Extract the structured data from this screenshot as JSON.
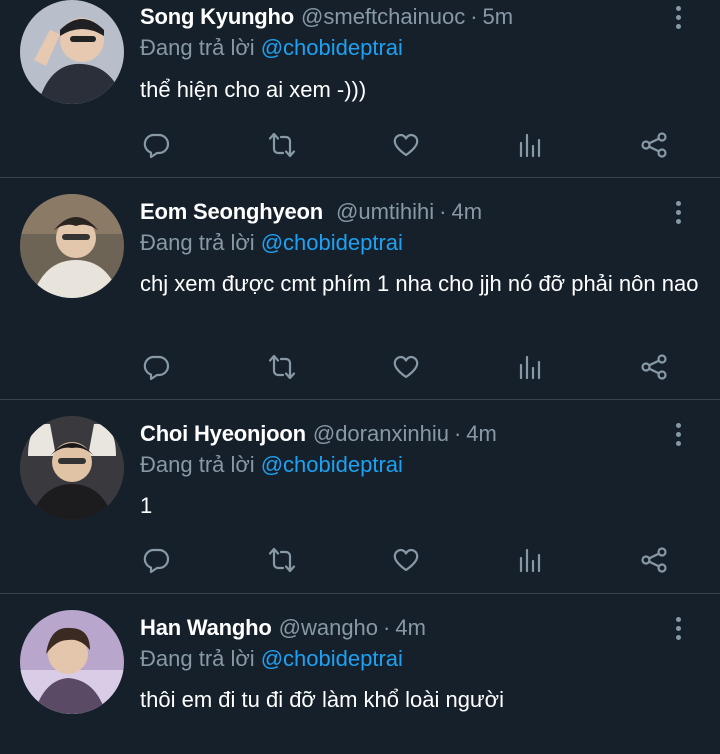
{
  "reply_prefix": "Đang trả lời",
  "colors": {
    "background": "#15202b",
    "muted": "#8899a6",
    "link": "#1da1f2",
    "divider": "#38444d"
  },
  "tweets": [
    {
      "name": "Song Kyungho",
      "handle": "@smeftchainuoc",
      "time": "5m",
      "replying_to": "@chobideptrai",
      "text": "thể hiện cho ai xem -)))",
      "avatar_colors": [
        "#c9ccd6",
        "#2b2f3a"
      ]
    },
    {
      "name": "Eom Seonghyeon",
      "handle": "@umtihihi",
      "time": "4m",
      "replying_to": "@chobideptrai",
      "text": "chj xem được cmt phím 1 nha cho jjh nó đỡ phải nôn nao",
      "avatar_colors": [
        "#8a7a66",
        "#e8e4dc"
      ]
    },
    {
      "name": "Choi Hyeonjoon",
      "handle": "@doranxinhiu",
      "time": "4m",
      "replying_to": "@chobideptrai",
      "text": "1",
      "avatar_colors": [
        "#e9e6e0",
        "#1c1c1f"
      ]
    },
    {
      "name": "Han Wangho",
      "handle": "@wangho",
      "time": "4m",
      "replying_to": "@chobideptrai",
      "text": "thôi em đi tu đi đỡ làm khổ loài người",
      "avatar_colors": [
        "#c9b8d8",
        "#5a4a66"
      ]
    }
  ],
  "action_icons": [
    "reply-icon",
    "retweet-icon",
    "like-icon",
    "analytics-icon",
    "share-icon"
  ]
}
